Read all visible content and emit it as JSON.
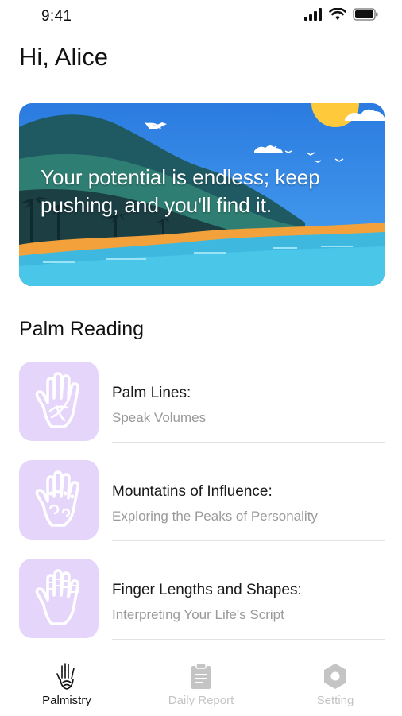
{
  "status_bar": {
    "time": "9:41"
  },
  "greeting": "Hi, Alice",
  "hero": {
    "quote": "Your potential is endless; keep pushing, and you'll find it."
  },
  "section": {
    "title": "Palm Reading"
  },
  "readings": [
    {
      "title": "Palm Lines:",
      "subtitle": "Speak Volumes",
      "icon": "palm-lines-icon"
    },
    {
      "title": "Mountatins of Influence:",
      "subtitle": "Exploring the Peaks of Personality",
      "icon": "palm-mounts-icon"
    },
    {
      "title": "Finger Lengths and Shapes:",
      "subtitle": "Interpreting Your Life's Script",
      "icon": "finger-lengths-icon"
    }
  ],
  "tab_bar": {
    "tabs": [
      {
        "label": "Palmistry",
        "icon": "palm-hand-icon",
        "active": true
      },
      {
        "label": "Daily Report",
        "icon": "clipboard-icon",
        "active": false
      },
      {
        "label": "Setting",
        "icon": "hexagon-gear-icon",
        "active": false
      }
    ]
  },
  "colors": {
    "thumb_bg": "#e6d5fa",
    "sky": "#2f7fe0",
    "sea": "#3fb8e0",
    "sun": "#ffc93c",
    "inactive_tab": "#c4c4c4"
  }
}
